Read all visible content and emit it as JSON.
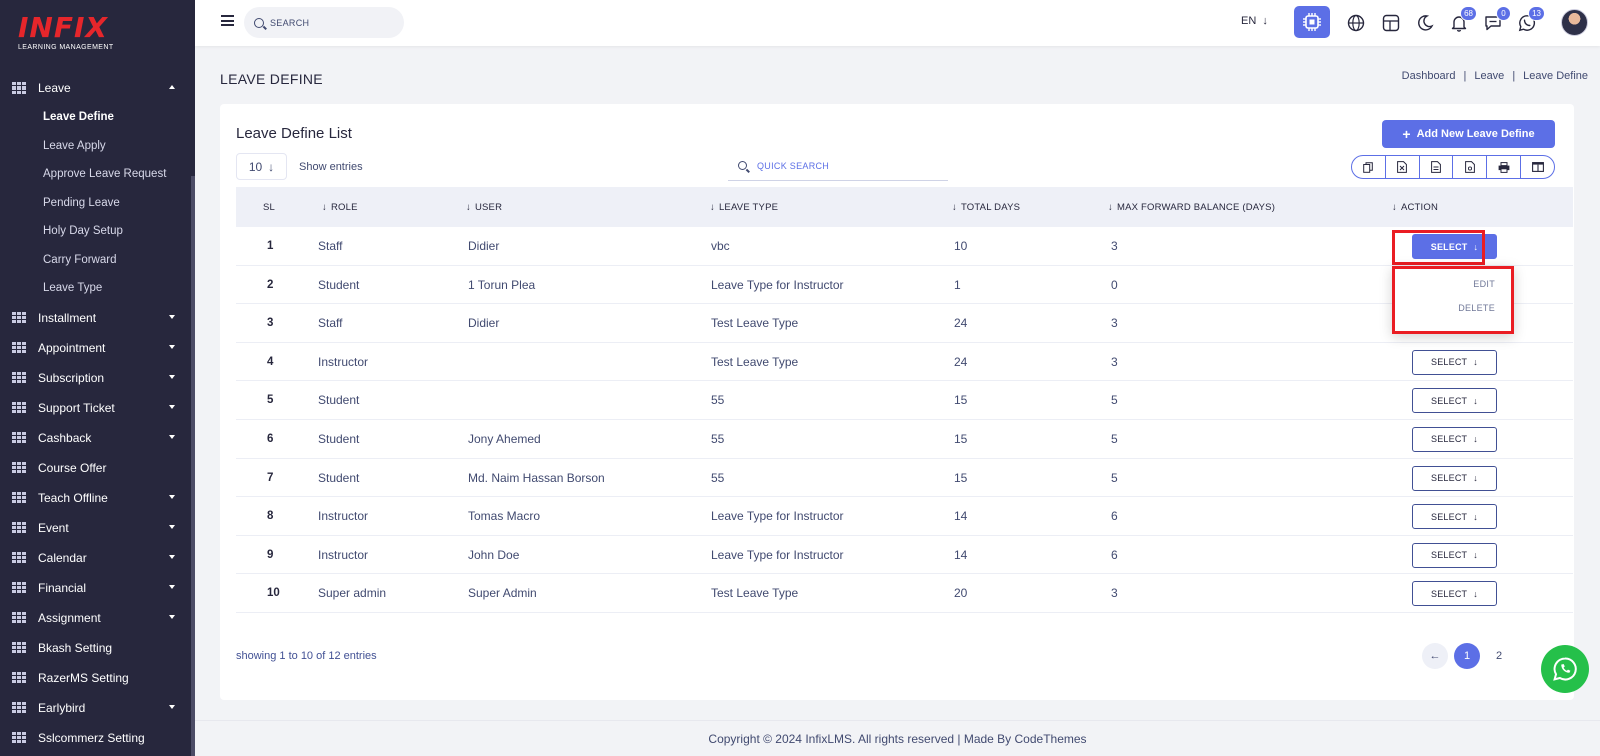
{
  "brand": {
    "logo_text": "INFIX",
    "logo_subtitle": "LEARNING MANAGEMENT",
    "accent_color": "#5c6fe6",
    "highlight_color": "#ea1d23"
  },
  "sidebar": {
    "items": [
      {
        "label": "Leave",
        "expanded": true
      },
      {
        "label": "Installment"
      },
      {
        "label": "Appointment"
      },
      {
        "label": "Subscription"
      },
      {
        "label": "Support Ticket"
      },
      {
        "label": "Cashback"
      },
      {
        "label": "Course Offer"
      },
      {
        "label": "Teach Offline"
      },
      {
        "label": "Event"
      },
      {
        "label": "Calendar"
      },
      {
        "label": "Financial"
      },
      {
        "label": "Assignment"
      },
      {
        "label": "Bkash Setting"
      },
      {
        "label": "RazerMS Setting"
      },
      {
        "label": "Earlybird"
      },
      {
        "label": "Sslcommerz Setting"
      }
    ],
    "leave_submenu": [
      "Leave Define",
      "Leave Apply",
      "Approve Leave Request",
      "Pending Leave",
      "Holy Day Setup",
      "Carry Forward",
      "Leave Type"
    ]
  },
  "topbar": {
    "search_placeholder": "SEARCH",
    "language": "EN",
    "notification_count": "68",
    "message_count": "0",
    "whatsapp_count": "13"
  },
  "page": {
    "title": "LEAVE DEFINE",
    "breadcrumb": [
      "Dashboard",
      "Leave",
      "Leave Define"
    ]
  },
  "card": {
    "title": "Leave Define List",
    "add_button": "Add New Leave Define",
    "entries_value": "10",
    "entries_label": "Show entries",
    "quick_search_placeholder": "QUICK SEARCH"
  },
  "table": {
    "headers": [
      "SL",
      "ROLE",
      "USER",
      "LEAVE TYPE",
      "TOTAL DAYS",
      "MAX FORWARD BALANCE (DAYS)",
      "ACTION"
    ],
    "select_label": "SELECT",
    "rows": [
      {
        "sl": "1",
        "role": "Staff",
        "user": "Didier",
        "leave_type": "vbc",
        "total_days": "10",
        "max_forward": "3"
      },
      {
        "sl": "2",
        "role": "Student",
        "user": "1 Torun Plea",
        "leave_type": "Leave Type for Instructor",
        "total_days": "1",
        "max_forward": "0"
      },
      {
        "sl": "3",
        "role": "Staff",
        "user": "Didier",
        "leave_type": "Test Leave Type",
        "total_days": "24",
        "max_forward": "3"
      },
      {
        "sl": "4",
        "role": "Instructor",
        "user": "",
        "leave_type": "Test Leave Type",
        "total_days": "24",
        "max_forward": "3"
      },
      {
        "sl": "5",
        "role": "Student",
        "user": "",
        "leave_type": "55",
        "total_days": "15",
        "max_forward": "5"
      },
      {
        "sl": "6",
        "role": "Student",
        "user": "Jony Ahemed",
        "leave_type": "55",
        "total_days": "15",
        "max_forward": "5"
      },
      {
        "sl": "7",
        "role": "Student",
        "user": "Md. Naim Hassan Borson",
        "leave_type": "55",
        "total_days": "15",
        "max_forward": "5"
      },
      {
        "sl": "8",
        "role": "Instructor",
        "user": "Tomas Macro",
        "leave_type": "Leave Type for Instructor",
        "total_days": "14",
        "max_forward": "6"
      },
      {
        "sl": "9",
        "role": "Instructor",
        "user": "John Doe",
        "leave_type": "Leave Type for Instructor",
        "total_days": "14",
        "max_forward": "6"
      },
      {
        "sl": "10",
        "role": "Super admin",
        "user": "Super Admin",
        "leave_type": "Test Leave Type",
        "total_days": "20",
        "max_forward": "3"
      }
    ],
    "dropdown": {
      "edit": "EDIT",
      "delete": "DELETE"
    }
  },
  "pagination": {
    "showing": "showing 1 to 10 of 12 entries",
    "pages": [
      "1",
      "2"
    ]
  },
  "footer": {
    "text": "Copyright © 2024 InfixLMS. All rights reserved | Made By CodeThemes"
  }
}
